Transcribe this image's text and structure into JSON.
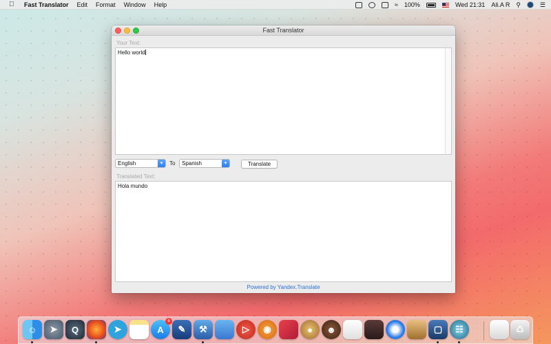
{
  "menubar": {
    "app_name": "Fast Translator",
    "items": [
      "Edit",
      "Format",
      "Window",
      "Help"
    ],
    "battery_text": "100%",
    "clock": "Wed 21:31",
    "user": "Ali.A R"
  },
  "window": {
    "title": "Fast Translator",
    "input_label": "Your Text:",
    "input_text": "Hello world",
    "from_language": "English",
    "to_label": "To",
    "to_language": "Spanish",
    "translate_button": "Translate",
    "output_label": "Translated Text:",
    "output_text": "Hola mundo",
    "powered_by": "Powered by Yandex.Translate"
  },
  "dock": {
    "app_store_badge": "6",
    "icons": [
      "finder-icon",
      "launchpad-icon",
      "quicktime-icon",
      "firefox-icon",
      "telegram-icon",
      "notes-icon",
      "app-store-icon",
      "preview-icon",
      "xcode-icon",
      "migration-icon",
      "photobooth-icon",
      "blender-icon",
      "sketchbook-icon",
      "paint-icon",
      "uninstaller-icon",
      "textedit-icon",
      "photo-collage-icon",
      "safari-icon",
      "stuffit-icon",
      "virtualbox-icon",
      "network-icon",
      "downloads-icon",
      "trash-icon"
    ]
  },
  "colors": {
    "accent": "#2f7ff0",
    "link": "#2c6fd4"
  }
}
